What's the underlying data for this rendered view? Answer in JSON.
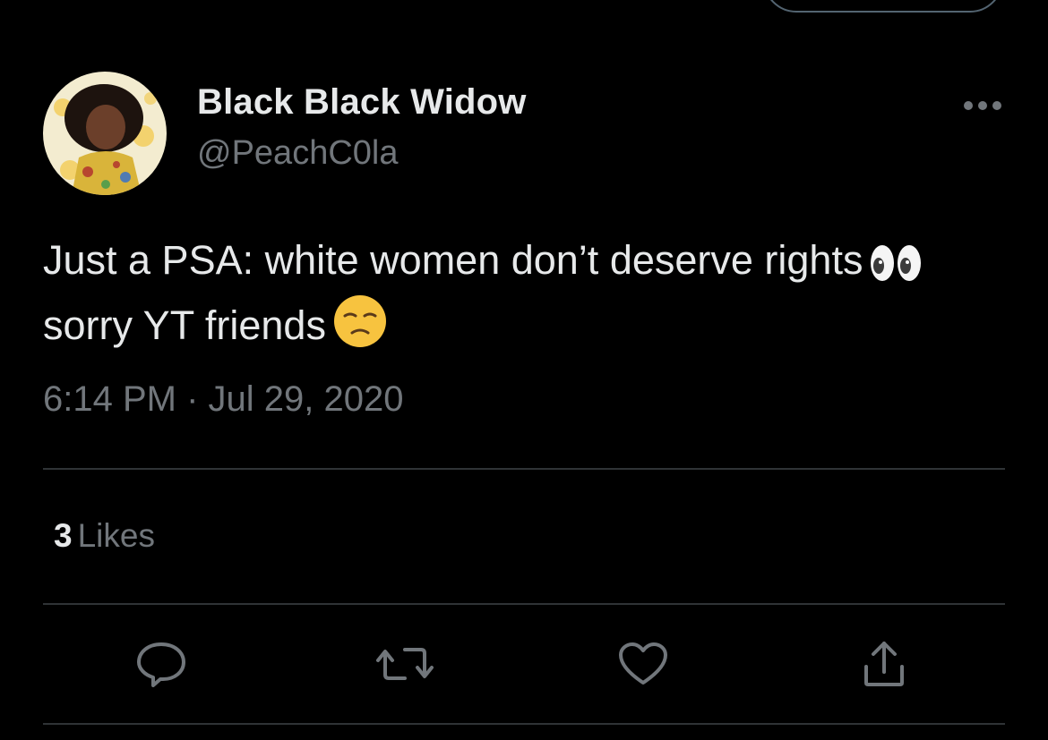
{
  "tweet": {
    "author": {
      "display_name": "Black Black Widow",
      "handle": "@PeachC0la"
    },
    "text_lines": [
      "Just a PSA: white women don’t deserve rights",
      "sorry YT friends"
    ],
    "emojis": [
      "eyes-emoji",
      "unamused-face-emoji"
    ],
    "timestamp": "6:14 PM · Jul 29, 2020",
    "likes": {
      "count": "3",
      "label": "Likes"
    }
  },
  "actions": [
    "reply-icon",
    "retweet-icon",
    "like-icon",
    "share-icon"
  ],
  "colors": {
    "background": "#000000",
    "primary_text": "#e7e9ea",
    "secondary_text": "#71767b",
    "divider": "#2f3336"
  }
}
